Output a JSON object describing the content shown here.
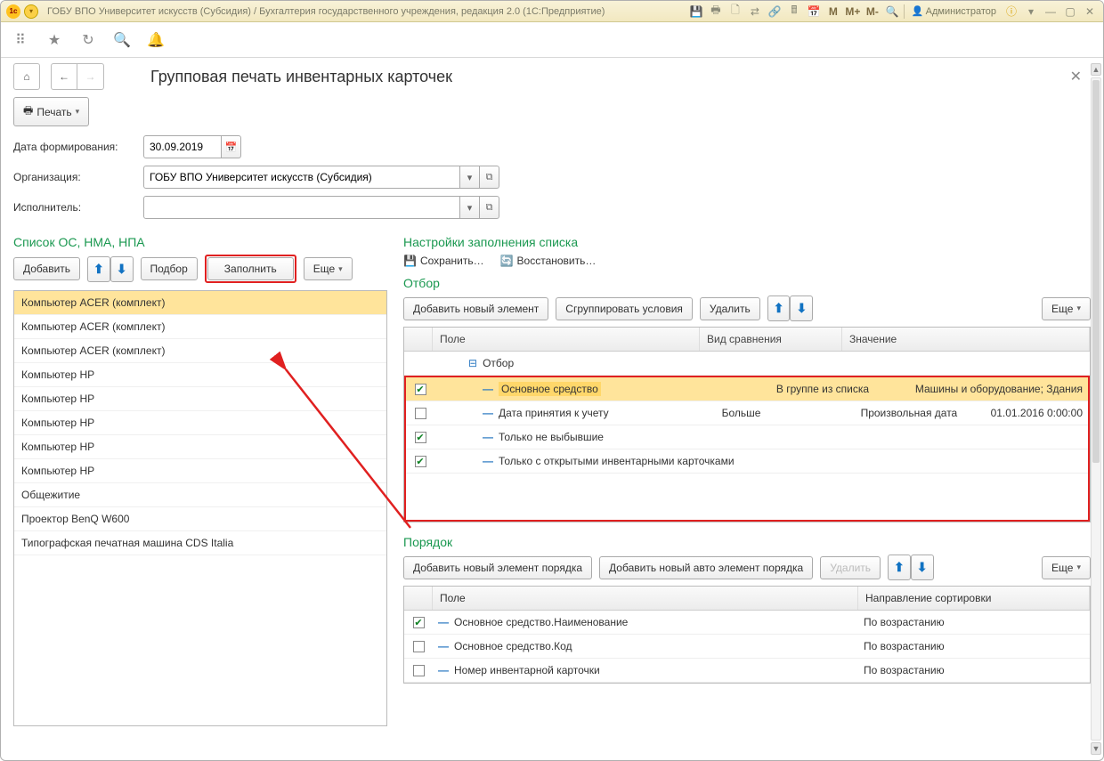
{
  "titlebar": {
    "title": "ГОБУ ВПО Университет искусств (Субсидия) / Бухгалтерия государственного учреждения, редакция 2.0  (1С:Предприятие)",
    "user": "Администратор",
    "m_labels": [
      "M",
      "M+",
      "M-"
    ]
  },
  "page": {
    "title": "Групповая печать инвентарных карточек",
    "print_label": "Печать"
  },
  "form": {
    "date_label": "Дата формирования:",
    "date_value": "30.09.2019",
    "org_label": "Организация:",
    "org_value": "ГОБУ ВПО Университет искусств (Субсидия)",
    "executor_label": "Исполнитель:",
    "executor_value": ""
  },
  "list": {
    "heading": "Список ОС, НМА, НПА",
    "add": "Добавить",
    "select": "Подбор",
    "fill": "Заполнить",
    "more": "Еще",
    "items": [
      "Компьютер ACER (комплект)",
      "Компьютер ACER (комплект)",
      "Компьютер ACER (комплект)",
      "Компьютер HP",
      "Компьютер HP",
      "Компьютер HP",
      "Компьютер HP",
      "Компьютер HP",
      "Общежитие",
      "Проектор BenQ W600",
      "Типографская печатная машина CDS Italia"
    ]
  },
  "settings": {
    "heading": "Настройки заполнения списка",
    "save": "Сохранить…",
    "restore": "Восстановить…"
  },
  "filter": {
    "heading": "Отбор",
    "add": "Добавить новый элемент",
    "group": "Сгруппировать условия",
    "delete": "Удалить",
    "more": "Еще",
    "cols": {
      "field": "Поле",
      "cmp": "Вид сравнения",
      "value": "Значение"
    },
    "root": "Отбор",
    "rows": [
      {
        "checked": true,
        "field": "Основное средство",
        "cmp": "В группе из списка",
        "value": "Машины и оборудование; Здания",
        "selected": true
      },
      {
        "checked": false,
        "field": "Дата принятия к учету",
        "cmp": "Больше",
        "value_pre": "Произвольная дата",
        "value": "01.01.2016 0:00:00"
      },
      {
        "checked": true,
        "field": "Только не выбывшие",
        "cmp": "",
        "value": ""
      },
      {
        "checked": true,
        "field": "Только с открытыми инвентарными карточками",
        "cmp": "",
        "value": ""
      }
    ]
  },
  "order": {
    "heading": "Порядок",
    "add": "Добавить новый элемент порядка",
    "add_auto": "Добавить новый авто элемент порядка",
    "delete": "Удалить",
    "more": "Еще",
    "cols": {
      "field": "Поле",
      "direction": "Направление сортировки"
    },
    "rows": [
      {
        "checked": true,
        "field": "Основное средство.Наименование",
        "dir": "По возрастанию"
      },
      {
        "checked": false,
        "field": "Основное средство.Код",
        "dir": "По возрастанию"
      },
      {
        "checked": false,
        "field": "Номер инвентарной карточки",
        "dir": "По возрастанию"
      }
    ]
  }
}
